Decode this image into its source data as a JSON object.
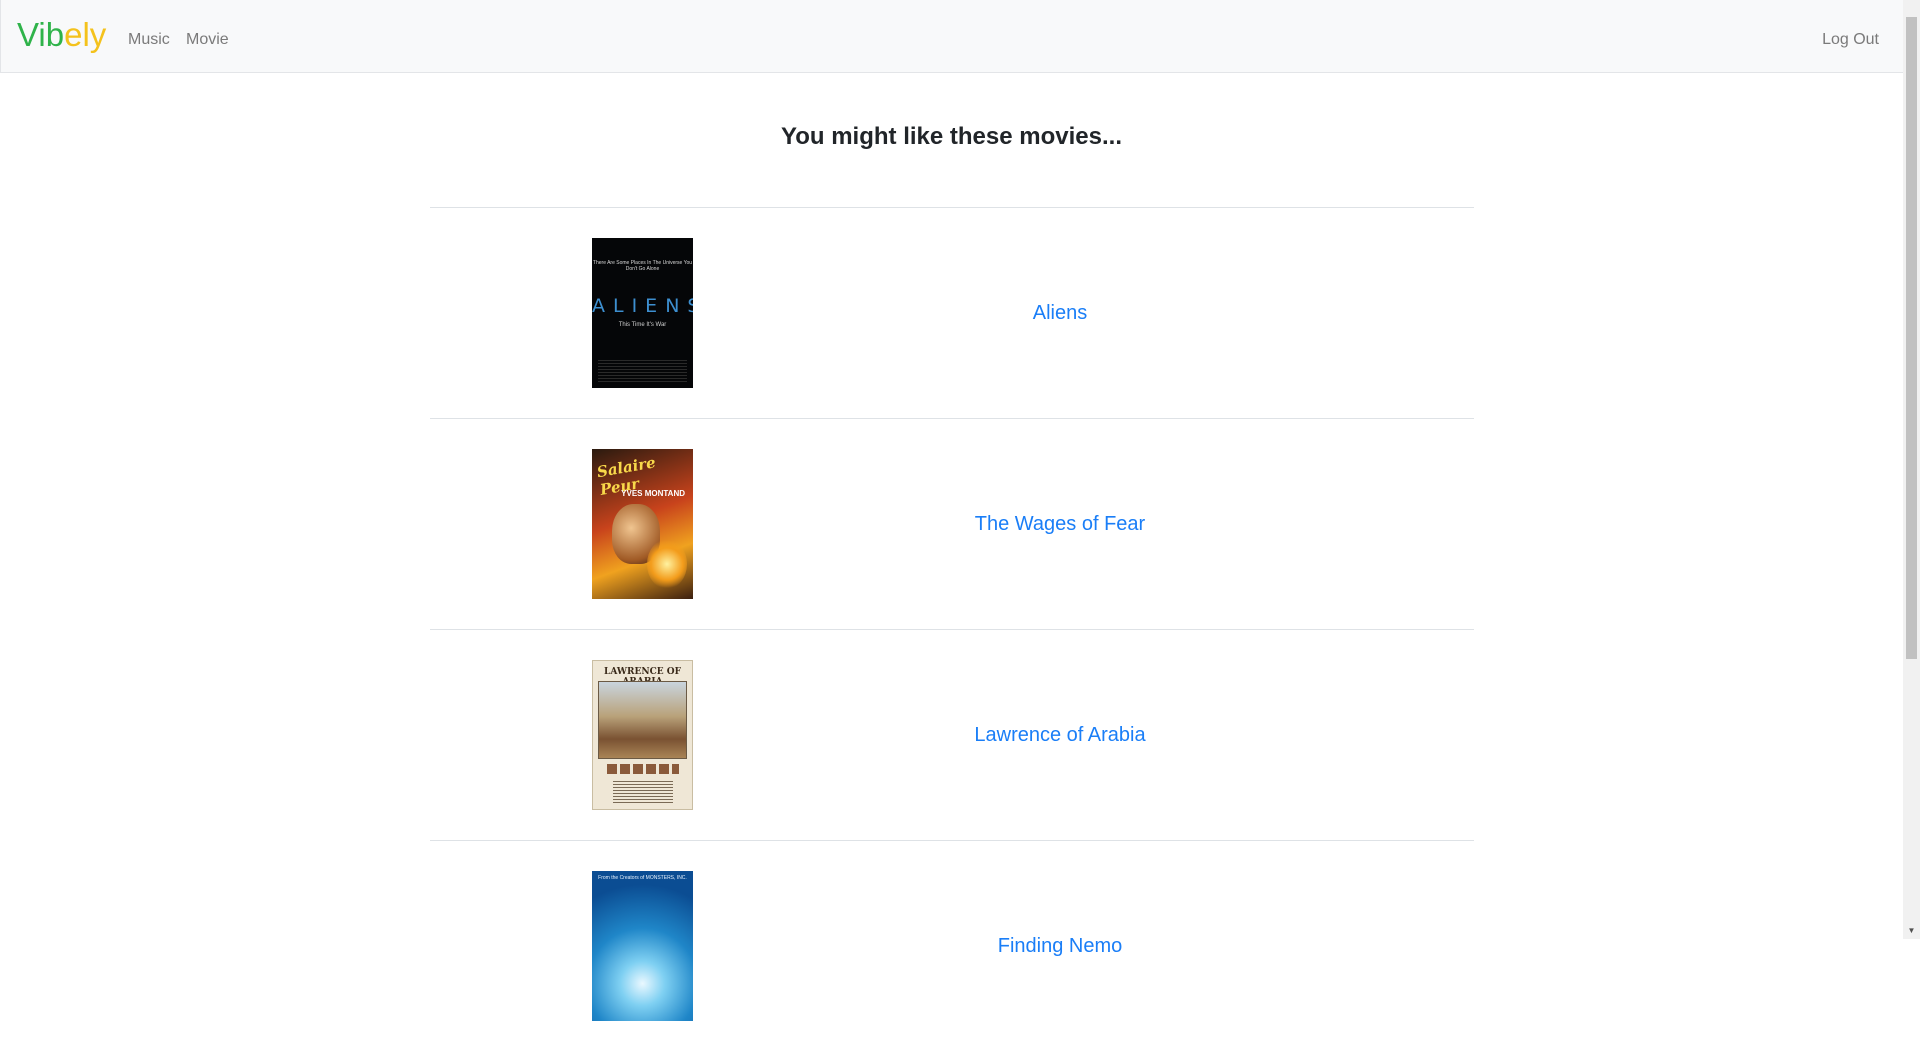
{
  "navbar": {
    "brand_part1": "Vib",
    "brand_part2": "ely",
    "links": [
      "Music",
      "Movie"
    ],
    "logout_label": "Log Out"
  },
  "heading": "You might like these movies...",
  "movies": [
    {
      "title": "Aliens",
      "poster": {
        "tagline_top": "There Are Some Places In The Universe You Don't Go Alone",
        "logo": "ALIENS",
        "tagline_sub": "This Time It's War"
      }
    },
    {
      "title": "The Wages of Fear",
      "poster": {
        "title_text": "Salaire Peur",
        "star": "YVES MONTAND"
      }
    },
    {
      "title": "Lawrence of Arabia",
      "poster": {
        "title_text": "LAWRENCE OF ARABIA"
      }
    },
    {
      "title": "Finding Nemo",
      "poster": {
        "top_text": "From the Creators of MONSTERS, INC."
      }
    }
  ],
  "colors": {
    "brand_green": "#2fb34a",
    "brand_yellow": "#f4c21c",
    "link_blue": "#1a7ef7",
    "navbar_bg": "#f8f9fa"
  }
}
